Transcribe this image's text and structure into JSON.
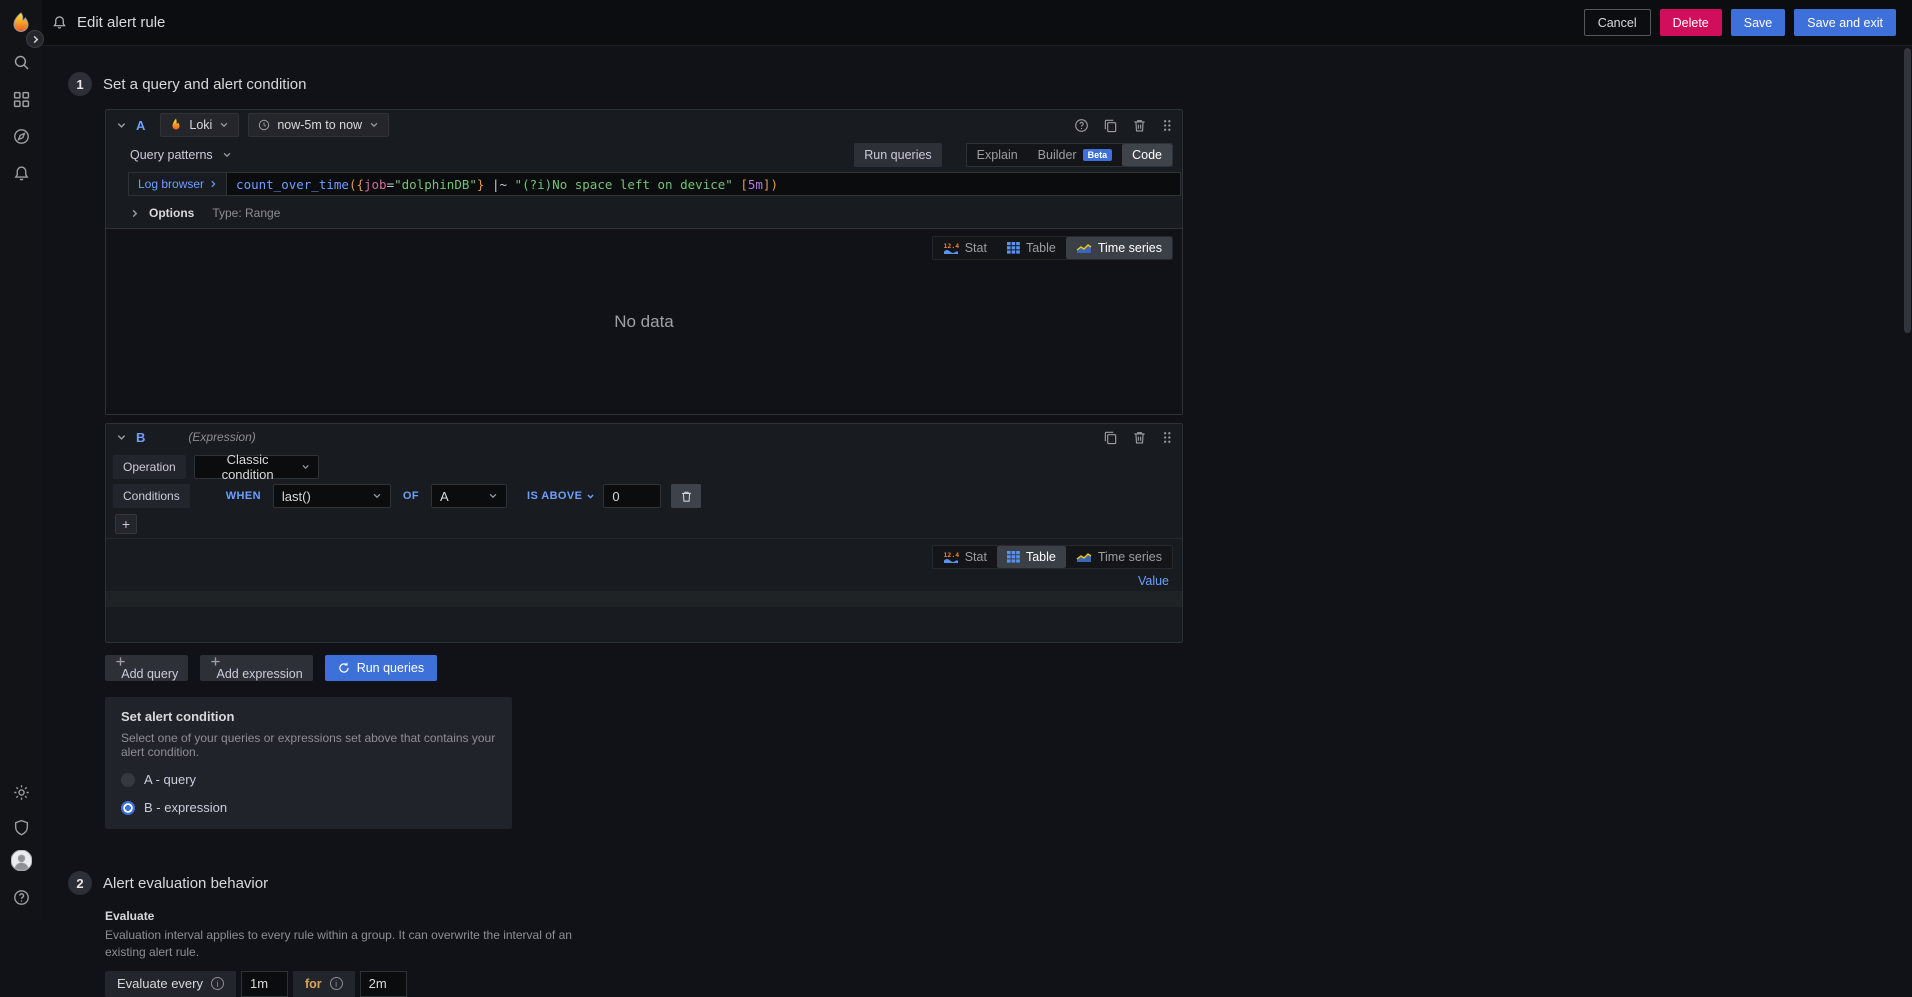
{
  "topbar": {
    "title": "Edit alert rule",
    "cancel": "Cancel",
    "delete": "Delete",
    "save": "Save",
    "save_and_exit": "Save and exit"
  },
  "step1": {
    "number": "1",
    "title": "Set a query and alert condition",
    "query_a": {
      "ref_id": "A",
      "datasource": "Loki",
      "time_range": "now-5m to now",
      "query_patterns_label": "Query patterns",
      "run_queries_label": "Run queries",
      "mode_explain": "Explain",
      "mode_builder": "Builder",
      "mode_builder_badge": "Beta",
      "mode_code": "Code",
      "log_browser_label": "Log browser",
      "query_text": "count_over_time({job=\"dolphinDB\"} |~ \"(?i)No space left on device\" [5m])",
      "query_segments": [
        {
          "text": "count_over_time",
          "tok": "fn"
        },
        {
          "text": "({",
          "tok": "paren"
        },
        {
          "text": "job",
          "tok": "label"
        },
        {
          "text": "=",
          "tok": "op"
        },
        {
          "text": "\"dolphinDB\"",
          "tok": "str"
        },
        {
          "text": "}",
          "tok": "paren"
        },
        {
          "text": " |~ ",
          "tok": "op"
        },
        {
          "text": "\"(?i)No space left on device\"",
          "tok": "str"
        },
        {
          "text": " [",
          "tok": "paren"
        },
        {
          "text": "5m",
          "tok": "dur"
        },
        {
          "text": "])",
          "tok": "paren"
        }
      ],
      "options_label": "Options",
      "options_type": "Type: Range",
      "viz_stat": "Stat",
      "viz_table": "Table",
      "viz_time_series": "Time series",
      "viz_selected": "Time series",
      "no_data": "No data"
    },
    "expression_b": {
      "ref_id": "B",
      "type_label": "(Expression)",
      "operation_label": "Operation",
      "operation_value": "Classic condition",
      "conditions_label": "Conditions",
      "when_label": "WHEN",
      "when_func": "last()",
      "of_label": "OF",
      "of_value": "A",
      "evaluator": "IS ABOVE",
      "threshold": "0",
      "add_condition_label": "+",
      "viz_stat": "Stat",
      "viz_table": "Table",
      "viz_time_series": "Time series",
      "viz_selected": "Table",
      "table_col_value": "Value"
    },
    "actions": {
      "add_query": "Add query",
      "add_expression": "Add expression",
      "run_queries": "Run queries"
    },
    "alert_condition": {
      "title": "Set alert condition",
      "description": "Select one of your queries or expressions set above that contains your alert condition.",
      "options": [
        {
          "label": "A - query",
          "selected": false
        },
        {
          "label": "B - expression",
          "selected": true
        }
      ]
    }
  },
  "step2": {
    "number": "2",
    "title": "Alert evaluation behavior",
    "evaluate_title": "Evaluate",
    "evaluate_description": "Evaluation interval applies to every rule within a group. It can overwrite the interval of an existing alert rule.",
    "evaluate_every_label": "Evaluate every",
    "evaluate_every_value": "1m",
    "for_label": "for",
    "for_value": "2m"
  },
  "colors": {
    "accent_blue": "#3D71D9",
    "link_blue": "#6E9FFF",
    "delete_red": "#D10E5C",
    "code_function": "#6E9FFF",
    "code_paren": "#E09A4A",
    "code_label": "#D16D9E",
    "code_string": "#74C27A",
    "code_duration": "#B877D9",
    "background": "#111217",
    "panel_border": "#2C3235"
  }
}
